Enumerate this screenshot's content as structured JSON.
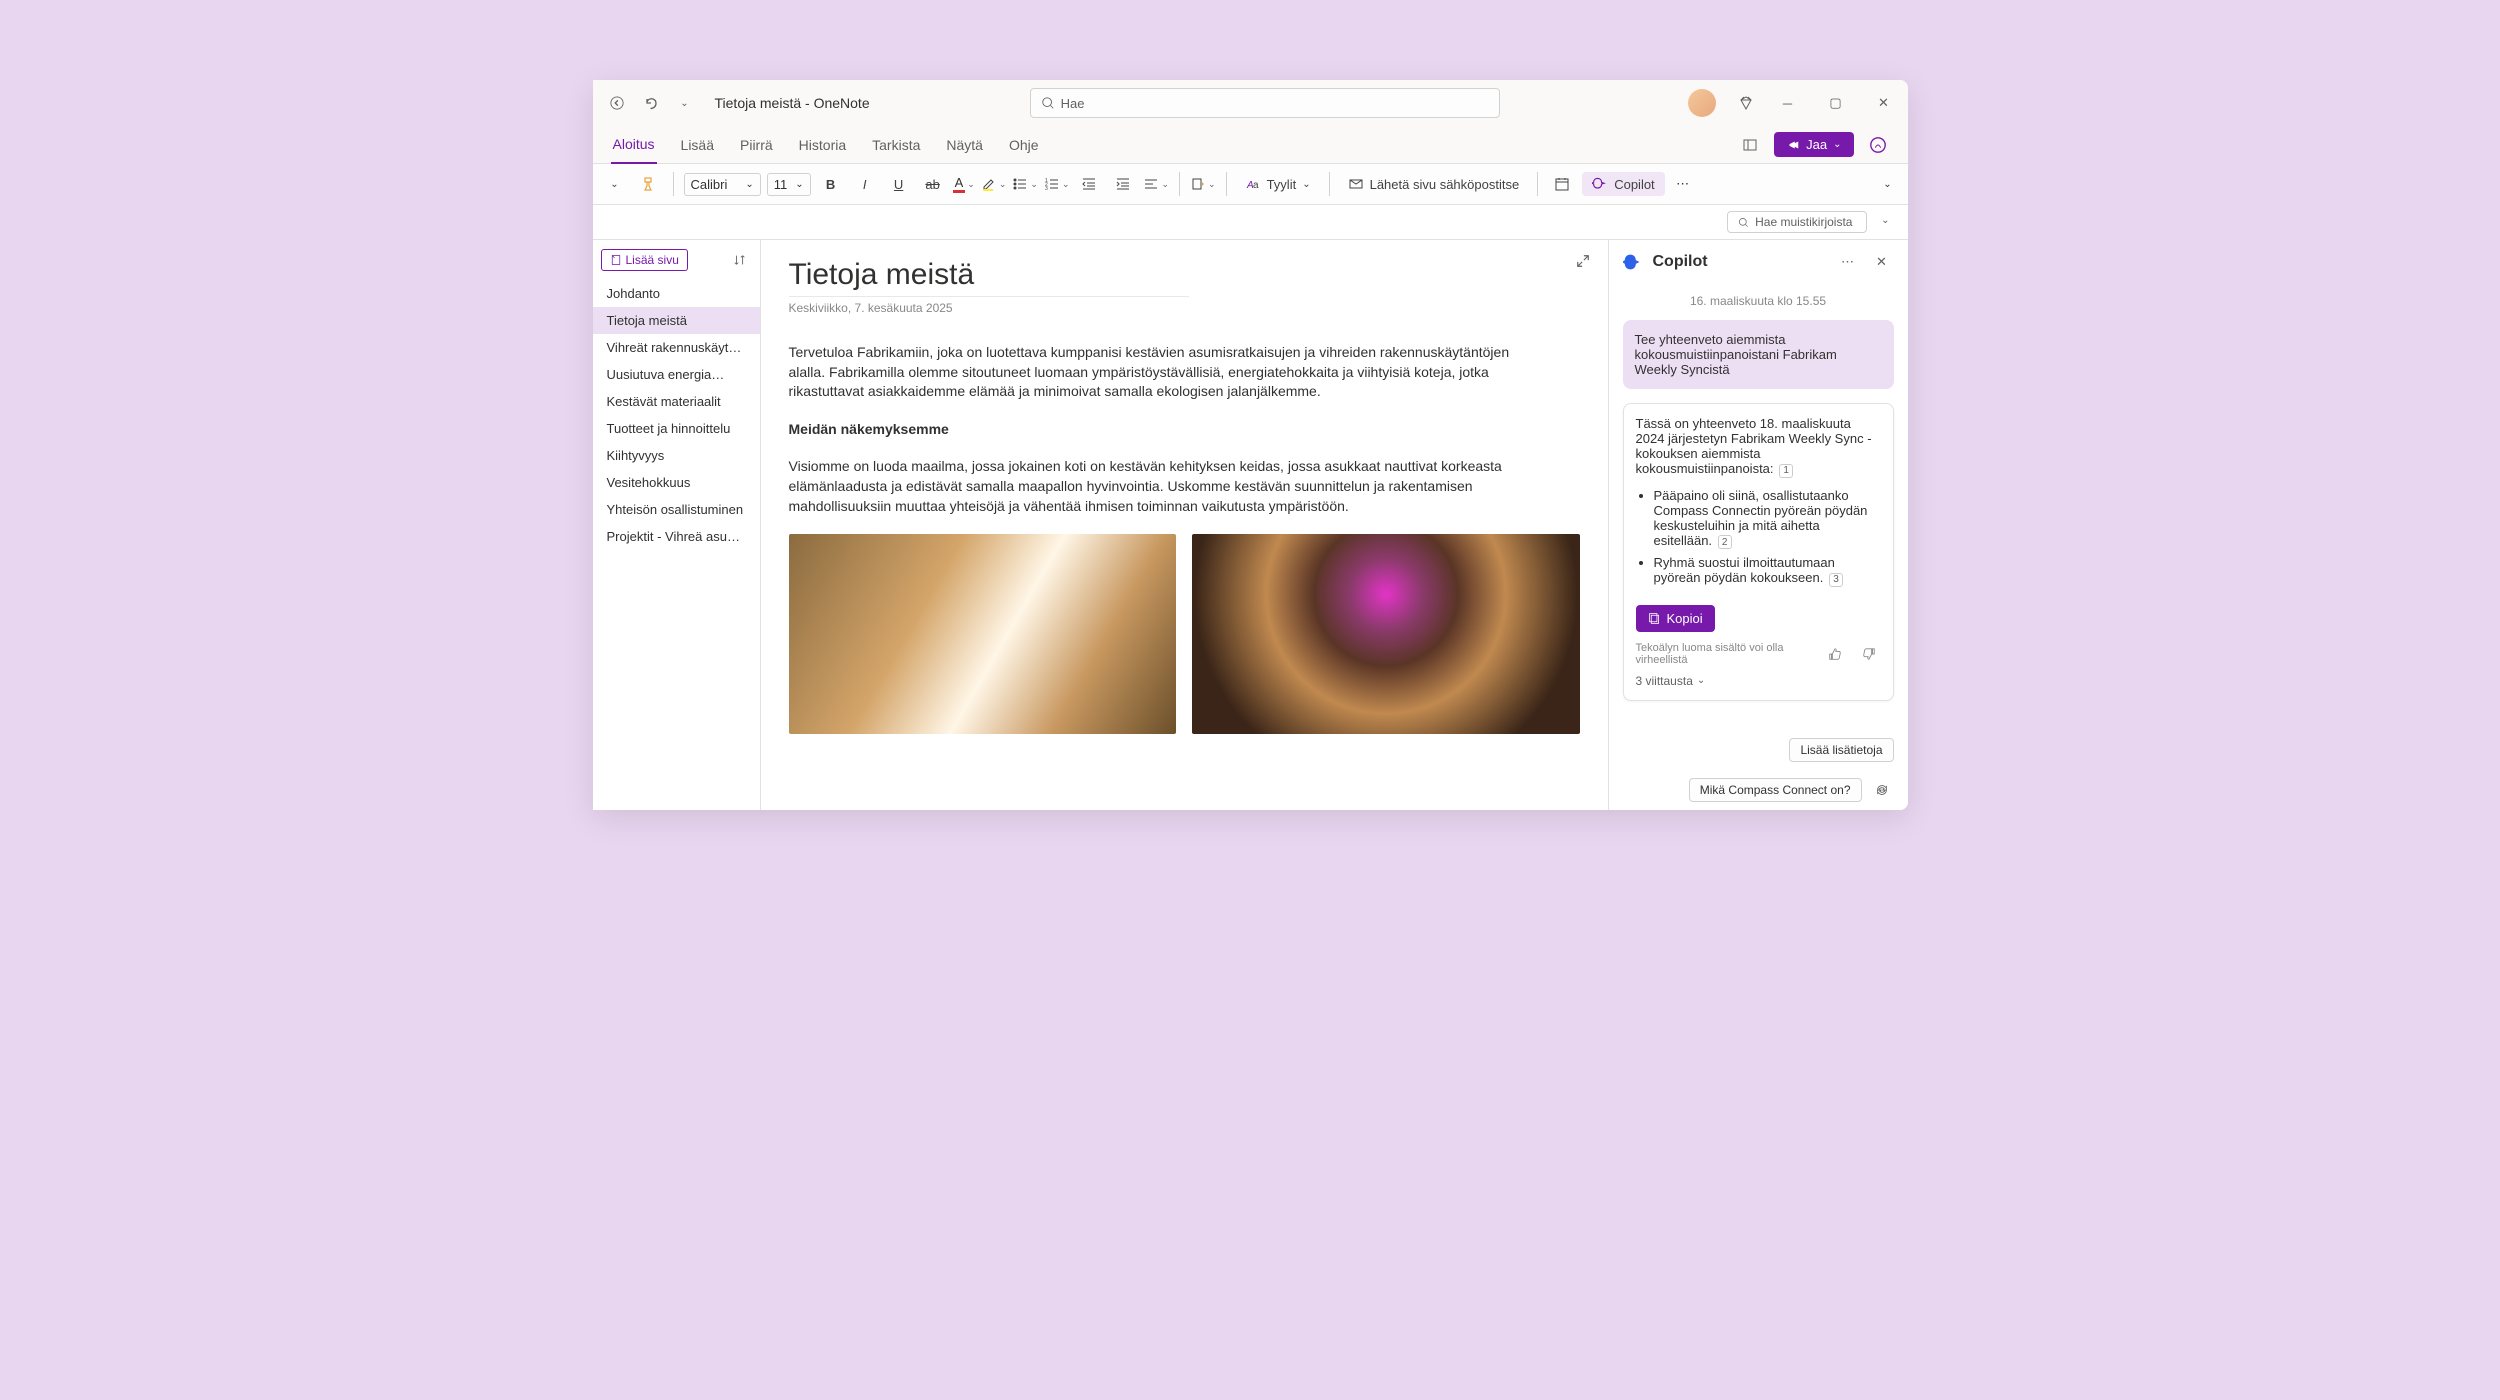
{
  "window": {
    "title": "Tietoja meistä - OneNote"
  },
  "search": {
    "placeholder": "Hae"
  },
  "ribbon": {
    "tabs": [
      "Aloitus",
      "Lisää",
      "Piirrä",
      "Historia",
      "Tarkista",
      "Näytä",
      "Ohje"
    ],
    "share": "Jaa"
  },
  "toolbar": {
    "font": "Calibri",
    "size": "11",
    "styles": "Tyylit",
    "send_mail": "Lähetä sivu sähköpostitse",
    "copilot": "Copilot"
  },
  "search_notebooks": "Hae muistikirjoista",
  "add_page": "Lisää sivu",
  "pages": [
    "Johdanto",
    "Tietoja meistä",
    "Vihreät rakennuskäytännöt",
    "Uusiutuva energia…",
    "Kestävät materiaalit",
    "Tuotteet ja hinnoittelu",
    "Kiihtyvyys",
    "Vesitehokkuus",
    "Yhteisön osallistuminen",
    "Projektit - Vihreä asukas…"
  ],
  "page": {
    "title": "Tietoja meistä",
    "date": "Keskiviikko, 7. kesäkuuta 2025",
    "p1": "Tervetuloa Fabrikamiin, joka on luotettava kumppanisi kestävien asumisratkaisujen ja vihreiden rakennuskäytäntöjen alalla. Fabrikamilla olemme sitoutuneet luomaan ympäristöystävällisiä, energiatehokkaita ja viihtyisiä koteja, jotka rikastuttavat asiakkaidemme elämää ja minimoivat samalla ekologisen jalanjälkemme.",
    "h1": "Meidän näkemyksemme",
    "p2": "Visiomme on luoda maailma, jossa jokainen koti on kestävän kehityksen keidas, jossa asukkaat nauttivat korkeasta elämänlaadusta ja edistävät samalla maapallon hyvinvointia. Uskomme kestävän suunnittelun ja rakentamisen mahdollisuuksiin muuttaa yhteisöjä ja vähentää ihmisen toiminnan vaikutusta ympäristöön."
  },
  "copilot": {
    "title": "Copilot",
    "timestamp": "16. maaliskuuta klo 15.55",
    "user_msg": "Tee yhteenveto aiemmista kokousmuistiinpanoistani Fabrikam Weekly Syncistä",
    "ai_intro": "Tässä on yhteenveto 18. maaliskuuta 2024 järjestetyn Fabrikam Weekly Sync -kokouksen aiemmista kokousmuistiinpanoista:",
    "ai_b1": "Pääpaino oli siinä, osallistutaanko Compass Connectin pyöreän pöydän keskusteluihin ja mitä aihetta esitellään.",
    "ai_b2": "Ryhmä suostui ilmoittautumaan pyöreän pöydän kokoukseen.",
    "copy": "Kopioi",
    "disclaimer": "Tekoälyn luoma sisältö voi olla virheellistä",
    "refs": "3 viittausta",
    "suggest1": "Lisää lisätietoja",
    "suggest2": "Mikä Compass Connect on?"
  }
}
